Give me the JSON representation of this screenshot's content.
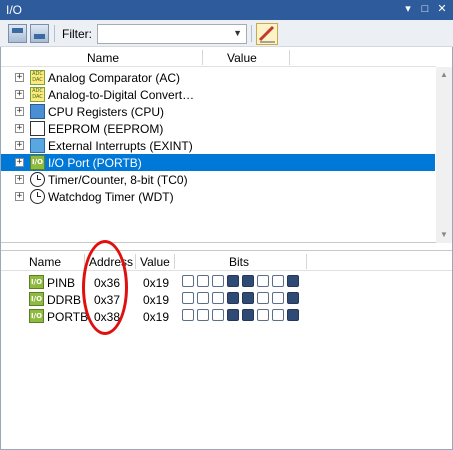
{
  "window": {
    "title": "I/O"
  },
  "toolbar": {
    "filter_label": "Filter:",
    "filter_value": ""
  },
  "upper": {
    "columns": [
      "Name",
      "Value"
    ],
    "items": [
      {
        "label": "Analog Comparator (AC)",
        "icon": "adc-icon",
        "icon_text": "ADC\nDAC"
      },
      {
        "label": "Analog-to-Digital Convert…",
        "icon": "adc-icon",
        "icon_text": "ADC\nDAC"
      },
      {
        "label": "CPU Registers (CPU)",
        "icon": "cpu-icon"
      },
      {
        "label": "EEPROM (EEPROM)",
        "icon": "eeprom-icon"
      },
      {
        "label": "External Interrupts (EXINT)",
        "icon": "interrupt-icon"
      },
      {
        "label": "I/O Port (PORTB)",
        "icon": "io-port-icon",
        "icon_text": "I/O",
        "selected": true
      },
      {
        "label": "Timer/Counter, 8-bit (TC0)",
        "icon": "clock-icon"
      },
      {
        "label": "Watchdog Timer (WDT)",
        "icon": "clock-icon"
      }
    ]
  },
  "lower": {
    "columns": [
      "Name",
      "Address",
      "Value",
      "Bits"
    ],
    "registers": [
      {
        "icon_text": "I/O",
        "name": "PINB",
        "address": "0x36",
        "value": "0x19",
        "bits": [
          0,
          0,
          0,
          1,
          1,
          0,
          0,
          1
        ]
      },
      {
        "icon_text": "I/O",
        "name": "DDRB",
        "address": "0x37",
        "value": "0x19",
        "bits": [
          0,
          0,
          0,
          1,
          1,
          0,
          0,
          1
        ]
      },
      {
        "icon_text": "I/O",
        "name": "PORTB",
        "address": "0x38",
        "value": "0x19",
        "bits": [
          0,
          0,
          0,
          1,
          1,
          0,
          0,
          1
        ]
      }
    ]
  },
  "colors": {
    "titlebar": "#2d5b9b",
    "selection": "#0078d7",
    "bit_on": "#2f4a73",
    "annotation": "#e01010"
  }
}
